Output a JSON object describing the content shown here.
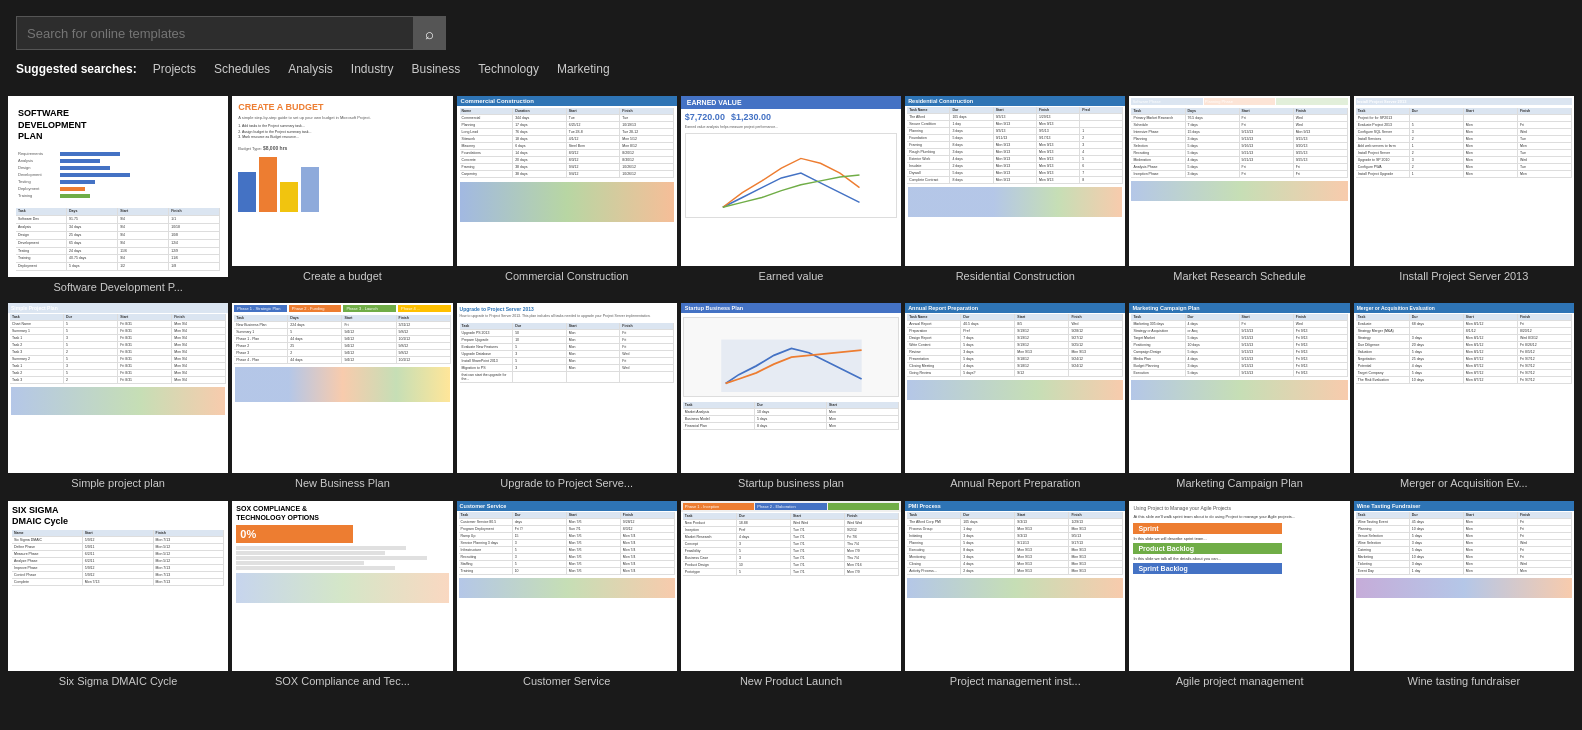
{
  "search": {
    "placeholder": "Search for online templates",
    "icon": "🔍"
  },
  "suggested": {
    "label": "Suggested searches:",
    "items": [
      "Projects",
      "Schedules",
      "Analysis",
      "Industry",
      "Business",
      "Technology",
      "Marketing"
    ]
  },
  "templates": {
    "row1": [
      {
        "id": "software-dev-plan",
        "label": "Software Development P..."
      },
      {
        "id": "create-budget",
        "label": "Create a budget"
      },
      {
        "id": "commercial-construction",
        "label": "Commercial Construction"
      },
      {
        "id": "earned-value",
        "label": "Earned value"
      },
      {
        "id": "residential-construction",
        "label": "Residential Construction"
      },
      {
        "id": "market-research",
        "label": "Market Research Schedule"
      },
      {
        "id": "install-project-server",
        "label": "Install Project Server 2013"
      }
    ],
    "row2": [
      {
        "id": "simple-project-plan",
        "label": "Simple project plan"
      },
      {
        "id": "new-business-plan",
        "label": "New Business Plan"
      },
      {
        "id": "upgrade-project-server",
        "label": "Upgrade to Project Serve..."
      },
      {
        "id": "startup-business-plan",
        "label": "Startup business plan"
      },
      {
        "id": "annual-report",
        "label": "Annual Report Preparation"
      },
      {
        "id": "marketing-campaign",
        "label": "Marketing Campaign Plan"
      },
      {
        "id": "merger-acquisition",
        "label": "Merger or Acquisition Ev..."
      }
    ],
    "row3": [
      {
        "id": "six-sigma",
        "label": "Six Sigma DMAIC Cycle"
      },
      {
        "id": "sox-compliance",
        "label": "SOX Compliance and Tec..."
      },
      {
        "id": "customer-service",
        "label": "Customer Service"
      },
      {
        "id": "new-product-launch",
        "label": "New Product Launch"
      },
      {
        "id": "project-management-inst",
        "label": "Project management inst..."
      },
      {
        "id": "agile-project",
        "label": "Agile project management"
      },
      {
        "id": "wine-tasting",
        "label": "Wine tasting fundraiser"
      }
    ]
  }
}
